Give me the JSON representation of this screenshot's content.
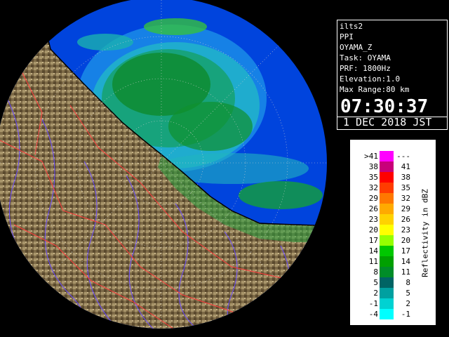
{
  "info": {
    "lines": [
      "ilts2",
      "PPI",
      "OYAMA_Z",
      "Task: OYAMA",
      "PRF: 1800Hz",
      "Elevation:1.0",
      "Max Range:80 km"
    ],
    "time": "07:30:37",
    "date": "1 DEC 2018 JST"
  },
  "legend": {
    "axis_label": "Reflectivity in dBZ",
    "rows": [
      {
        "lo": ">41",
        "hi": "---",
        "color": "#ff00ff"
      },
      {
        "lo": "38",
        "hi": "41",
        "color": "#c8007a"
      },
      {
        "lo": "35",
        "hi": "38",
        "color": "#ff0000"
      },
      {
        "lo": "32",
        "hi": "35",
        "color": "#ff3c00"
      },
      {
        "lo": "29",
        "hi": "32",
        "color": "#ff7800"
      },
      {
        "lo": "26",
        "hi": "29",
        "color": "#ffaa00"
      },
      {
        "lo": "23",
        "hi": "26",
        "color": "#ffd200"
      },
      {
        "lo": "20",
        "hi": "23",
        "color": "#ffff00"
      },
      {
        "lo": "17",
        "hi": "20",
        "color": "#96ff00"
      },
      {
        "lo": "14",
        "hi": "17",
        "color": "#00c800"
      },
      {
        "lo": "11",
        "hi": "14",
        "color": "#00a000"
      },
      {
        "lo": "8",
        "hi": "11",
        "color": "#008c28"
      },
      {
        "lo": "5",
        "hi": "8",
        "color": "#006464"
      },
      {
        "lo": "2",
        "hi": "5",
        "color": "#00a0a0"
      },
      {
        "lo": "-1",
        "hi": "2",
        "color": "#00d2d2"
      },
      {
        "lo": "-4",
        "hi": "-1",
        "color": "#00ffff"
      }
    ]
  },
  "map": {
    "sea_color": "#0044dd",
    "land_color": "#8a7a55",
    "background_color": "#000000"
  }
}
